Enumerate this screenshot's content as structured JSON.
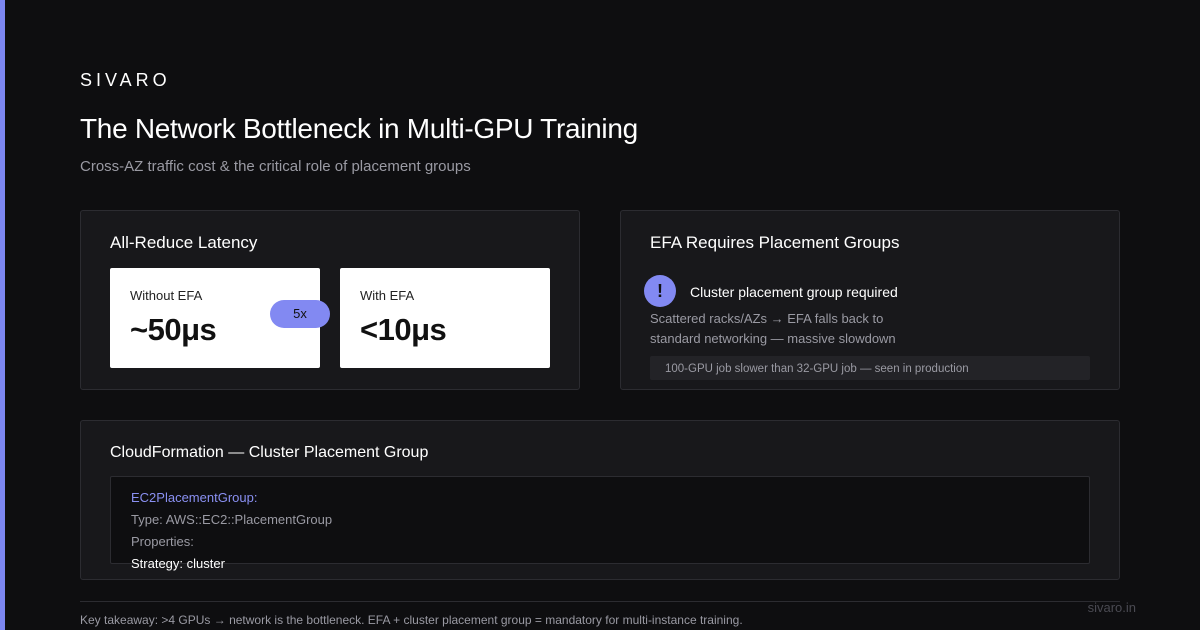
{
  "brand": "SIVARO",
  "title": "The Network Bottleneck in Multi-GPU Training",
  "subtitle": "Cross-AZ traffic cost & the critical role of placement groups",
  "latency_card": {
    "title": "All-Reduce Latency",
    "without": {
      "label": "Without EFA",
      "value": "~50μs"
    },
    "with": {
      "label": "With EFA",
      "value": "<10μs"
    },
    "badge": "5x"
  },
  "efa_card": {
    "title": "EFA Requires Placement Groups",
    "icon": "exclamation-icon",
    "icon_glyph": "!",
    "heading": "Cluster placement group required",
    "description": "Scattered racks/AZs → EFA falls back to standard networking — massive slowdown",
    "note": "100-GPU job slower than 32-GPU job — seen in production"
  },
  "cloudformation_card": {
    "title": "CloudFormation — Cluster Placement Group",
    "code": [
      "EC2PlacementGroup:",
      "Type: AWS::EC2::PlacementGroup",
      "Properties:",
      "Strategy: cluster"
    ]
  },
  "footer": {
    "takeaway": "Key takeaway: >4 GPUs → network is the bottleneck. EFA + cluster placement group = mandatory for multi-instance training.",
    "url": "sivaro.in"
  },
  "colors": {
    "background": "#0e0e10",
    "accent": "#8289f2",
    "card": "#18181b",
    "muted_text": "#9a9aa3"
  }
}
